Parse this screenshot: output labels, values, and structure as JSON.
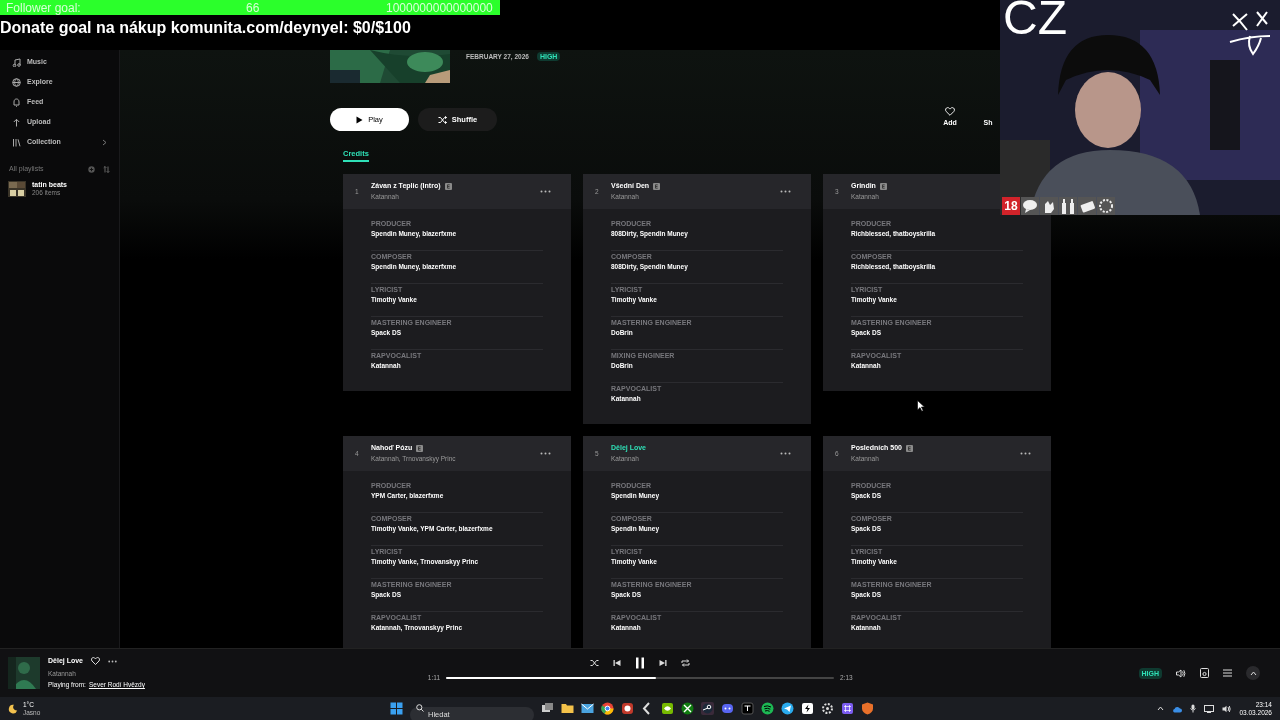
{
  "stream_overlay": {
    "follower_goal": {
      "label": "Follower goal:",
      "current": "66",
      "target": "1000000000000000"
    },
    "donate_text": "Donate goal na nákup komunita.com/deynyel: $0/$100",
    "webcam": {
      "channel_tag": "CZ",
      "rating_badge": "18"
    }
  },
  "sidebar": {
    "items": [
      {
        "label": "Music",
        "expandable": false
      },
      {
        "label": "Explore",
        "expandable": false
      },
      {
        "label": "Feed",
        "expandable": false
      },
      {
        "label": "Upload",
        "expandable": false
      },
      {
        "label": "Collection",
        "expandable": true
      }
    ],
    "playlists_heading": "All playlists",
    "playlists": [
      {
        "name": "tatin beats",
        "count": "206 items"
      }
    ]
  },
  "album": {
    "release_date": "FEBRUARY 27, 2026",
    "quality_badge": "HIGH",
    "buttons": [
      {
        "label": "Play",
        "kind": "primary"
      },
      {
        "label": "Shuffle",
        "kind": "secondary"
      }
    ],
    "actions": [
      {
        "label": "Add"
      },
      {
        "label": "Sh"
      }
    ],
    "tabs": [
      {
        "label": "Credits",
        "selected": true
      }
    ]
  },
  "credits": [
    {
      "number": "1",
      "title": "Závan z Teplic (Intro)",
      "explicit": true,
      "playing": false,
      "artist": "Katannah",
      "roles": [
        {
          "role": "PRODUCER",
          "names": "Spendin Muney, blazerfxme"
        },
        {
          "role": "COMPOSER",
          "names": "Spendin Muney, blazerfxme"
        },
        {
          "role": "LYRICIST",
          "names": "Timothy Vanke"
        },
        {
          "role": "MASTERING ENGINEER",
          "names": "Spack DS"
        },
        {
          "role": "RAPVOCALIST",
          "names": "Katannah"
        }
      ]
    },
    {
      "number": "2",
      "title": "Všední Den",
      "explicit": true,
      "playing": false,
      "artist": "Katannah",
      "roles": [
        {
          "role": "PRODUCER",
          "names": "808Dirty, Spendin Muney"
        },
        {
          "role": "COMPOSER",
          "names": "808Dirty, Spendin Muney"
        },
        {
          "role": "LYRICIST",
          "names": "Timothy Vanke"
        },
        {
          "role": "MASTERING ENGINEER",
          "names": "DoBrin"
        },
        {
          "role": "MIXING ENGINEER",
          "names": "DoBrin"
        },
        {
          "role": "RAPVOCALIST",
          "names": "Katannah"
        }
      ]
    },
    {
      "number": "3",
      "title": "Grindin",
      "explicit": true,
      "playing": false,
      "artist": "Katannah",
      "roles": [
        {
          "role": "PRODUCER",
          "names": "Richblessed, thatboyskrilla"
        },
        {
          "role": "COMPOSER",
          "names": "Richblessed, thatboyskrilla"
        },
        {
          "role": "LYRICIST",
          "names": "Timothy Vanke"
        },
        {
          "role": "MASTERING ENGINEER",
          "names": "Spack DS"
        },
        {
          "role": "RAPVOCALIST",
          "names": "Katannah"
        }
      ]
    },
    {
      "number": "4",
      "title": "Nahoď Pózu",
      "explicit": true,
      "playing": false,
      "artist": "Katannah, Trnovanskyy Princ",
      "roles": [
        {
          "role": "PRODUCER",
          "names": "YPM Carter, blazerfxme"
        },
        {
          "role": "COMPOSER",
          "names": "Timothy Vanke, YPM Carter, blazerfxme"
        },
        {
          "role": "LYRICIST",
          "names": "Timothy Vanke, Trnovanskyy Princ"
        },
        {
          "role": "MASTERING ENGINEER",
          "names": "Spack DS"
        },
        {
          "role": "RAPVOCALIST",
          "names": "Katannah, Trnovanskyy Princ"
        }
      ]
    },
    {
      "number": "5",
      "title": "Dělej Love",
      "explicit": false,
      "playing": true,
      "artist": "Katannah",
      "roles": [
        {
          "role": "PRODUCER",
          "names": "Spendin Muney"
        },
        {
          "role": "COMPOSER",
          "names": "Spendin Muney"
        },
        {
          "role": "LYRICIST",
          "names": "Timothy Vanke"
        },
        {
          "role": "MASTERING ENGINEER",
          "names": "Spack DS"
        },
        {
          "role": "RAPVOCALIST",
          "names": "Katannah"
        }
      ]
    },
    {
      "number": "6",
      "title": "Posledních 500",
      "explicit": true,
      "playing": false,
      "artist": "Katannah",
      "roles": [
        {
          "role": "PRODUCER",
          "names": "Spack DS"
        },
        {
          "role": "COMPOSER",
          "names": "Spack DS"
        },
        {
          "role": "LYRICIST",
          "names": "Timothy Vanke"
        },
        {
          "role": "MASTERING ENGINEER",
          "names": "Spack DS"
        },
        {
          "role": "RAPVOCALIST",
          "names": "Katannah"
        }
      ]
    }
  ],
  "player": {
    "title": "Dělej Love",
    "artist": "Katannah",
    "playing_from_label": "Playing from:",
    "playing_from": "Sever Rodí Hvězdy",
    "playing": true,
    "elapsed": "1:11",
    "duration": "2:13",
    "level": 0.54,
    "quality_badge": "HIGH"
  },
  "taskbar": {
    "weather": {
      "temperature": "1°C",
      "condition": "Jasno"
    },
    "search_placeholder": "Hledat",
    "time": "23:14",
    "date": "03.03.2026"
  }
}
